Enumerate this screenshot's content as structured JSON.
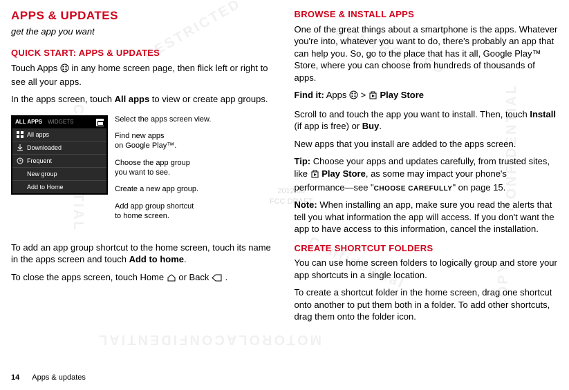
{
  "left": {
    "title": "APPS & UPDATES",
    "subtitle": "get the app you want",
    "quickstart_h": "QUICK START: APPS & UPDATES",
    "qs_p1a": "Touch Apps ",
    "qs_p1b": " in any home screen page, then flick left or right to see all your apps.",
    "qs_p2a": "In the apps screen, touch ",
    "qs_p2b": "All apps",
    "qs_p2c": " to view or create app groups.",
    "diagram": {
      "tab_all": "ALL APPS",
      "tab_widgets": "WIDGETS",
      "rows": [
        "All apps",
        "Downloaded",
        "Frequent",
        "New group",
        "Add to Home"
      ]
    },
    "callouts": {
      "c1": "Select the apps screen view.",
      "c2a": "Find new apps",
      "c2b": "on Google Play™.",
      "c3a": "Choose the app group",
      "c3b": "you want to see.",
      "c4": "Create a new app group.",
      "c5a": "Add app group shortcut",
      "c5b": "to home screen."
    },
    "p_add_a": "To add an app group shortcut to the home screen, touch its name in the apps screen and touch ",
    "p_add_b": "Add to home",
    "p_add_c": ".",
    "p_close_a": "To close the apps screen, touch Home ",
    "p_close_b": " or Back ",
    "p_close_c": "."
  },
  "right": {
    "browse_h": "BROWSE & INSTALL APPS",
    "b_p1": "One of the great things about a smartphone is the apps. Whatever you're into, whatever you want to do, there's probably an app that can help you. So, go to the place that has it all, Google Play™ Store, where you can choose from hundreds of thousands of apps.",
    "find_a": "Find it:",
    "find_b": " Apps ",
    "find_c": " > ",
    "find_d": " Play Store",
    "b_p2a": "Scroll to and touch the app you want to install. Then, touch ",
    "b_p2b": "Install",
    "b_p2c": " (if app is free) or ",
    "b_p2d": "Buy",
    "b_p2e": ".",
    "b_p3": "New apps that you install are added to the apps screen.",
    "tip_a": "Tip:",
    "tip_b": " Choose your apps and updates carefully, from trusted sites, like ",
    "tip_c": " Play Store",
    "tip_d": ", as some may impact your phone's performance—see \"",
    "tip_e": "CHOOSE CAREFULLY",
    "tip_f": "\" on page 15.",
    "note_a": "Note:",
    "note_b": " When installing an app, make sure you read the alerts that tell you what information the app will access. If you don't want the app to have access to this information, cancel the installation.",
    "folders_h": "CREATE SHORTCUT FOLDERS",
    "f_p1": "You can use home screen folders to logically group and store your app shortcuts in a single location.",
    "f_p2": "To create a shortcut folder in the home screen, drag one shortcut onto another to put them both in a folder. To add other shortcuts, drag them onto the folder icon."
  },
  "footer": {
    "page": "14",
    "section": "Apps & updates"
  },
  "stamp": {
    "l1": "2012.06",
    "l2": "FCC DRAFT"
  }
}
